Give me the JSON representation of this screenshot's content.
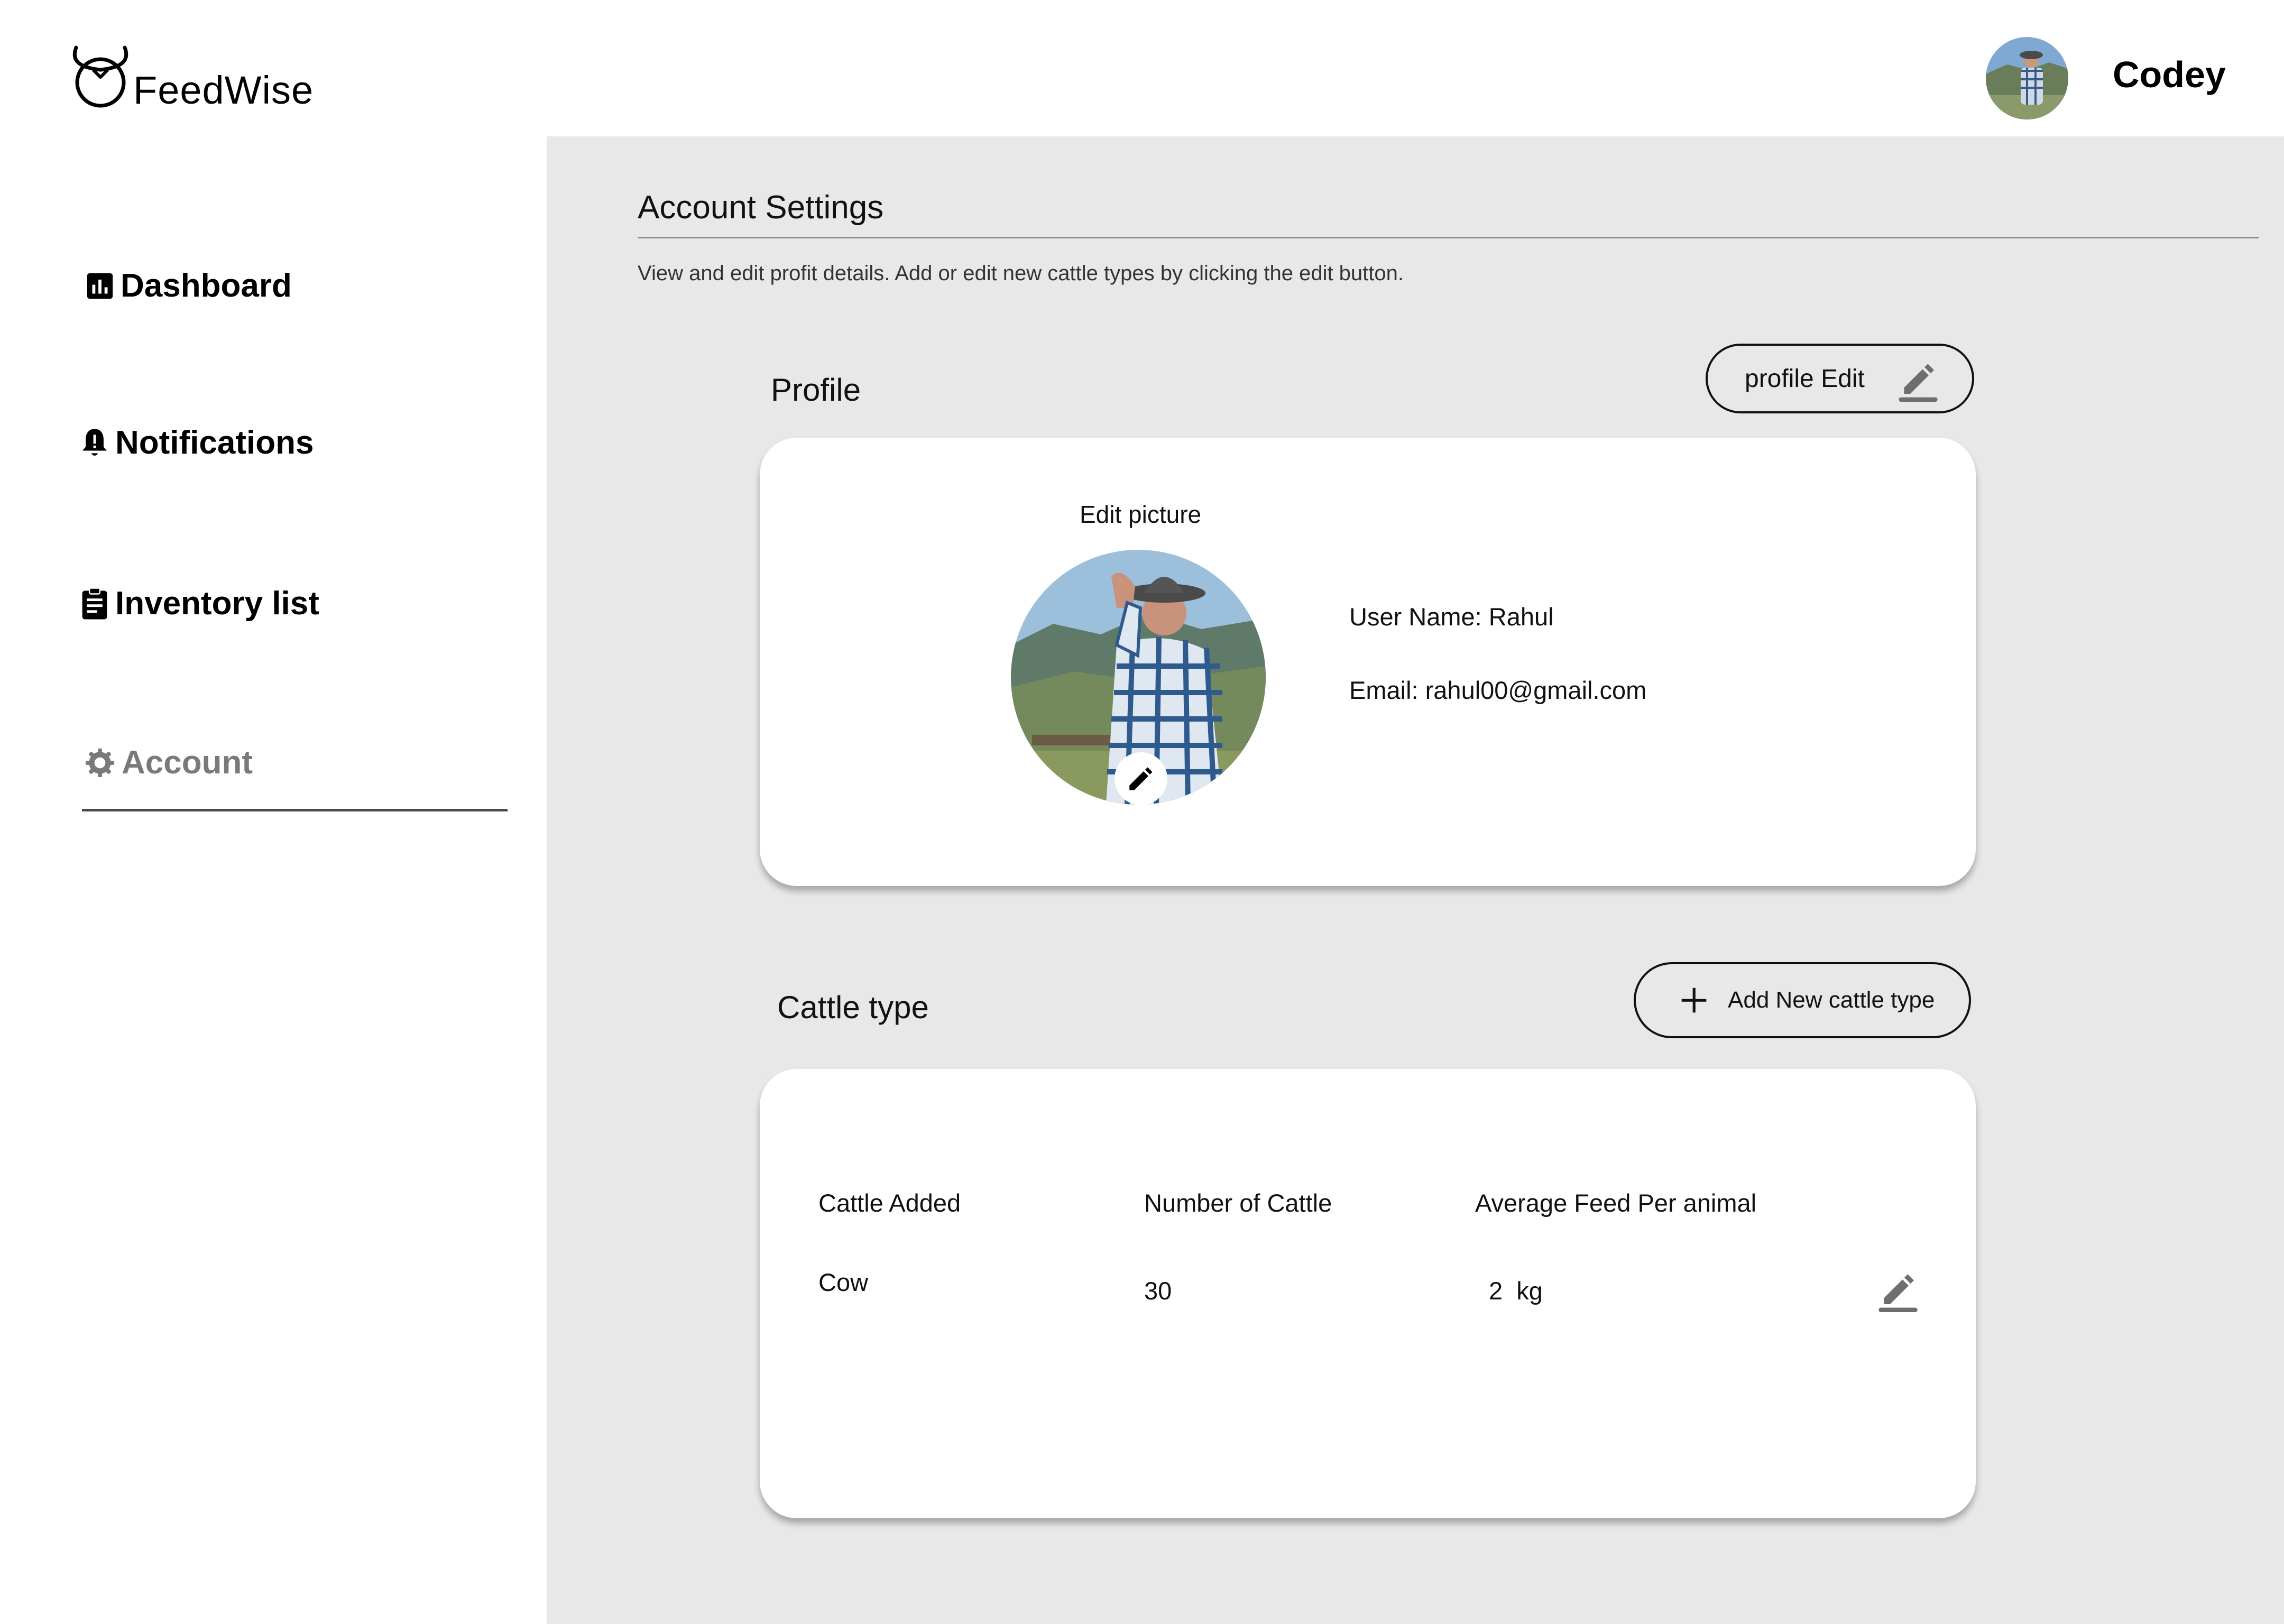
{
  "app": {
    "brand": "FeedWise",
    "user_name": "Codey"
  },
  "sidebar": {
    "items": [
      {
        "label": "Dashboard",
        "icon": "bar-chart-icon"
      },
      {
        "label": "Notifications",
        "icon": "bell-alert-icon"
      },
      {
        "label": "Inventory list",
        "icon": "clipboard-icon"
      },
      {
        "label": "Account",
        "icon": "gear-icon",
        "active": true
      }
    ]
  },
  "main": {
    "title": "Account Settings",
    "description": "View and edit profit details. Add or edit new cattle types by clicking the edit button."
  },
  "profile": {
    "section_title": "Profile",
    "edit_button_label": "profile Edit",
    "edit_picture_label": "Edit picture",
    "user_name_line": "User Name: Rahul",
    "email_line": "Email: rahul00@gmail.com"
  },
  "cattle": {
    "section_title": "Cattle type",
    "add_button_label": "Add New cattle type",
    "columns": [
      "Cattle Added",
      "Number of Cattle",
      "Average Feed Per animal"
    ],
    "rows": [
      {
        "type": "Cow",
        "count": "30",
        "feed": "2  kg"
      }
    ]
  },
  "colors": {
    "main_background": "#e8e8e8",
    "card_background": "#ffffff",
    "inactive_nav": "#7a7a7a",
    "text": "#111111"
  }
}
